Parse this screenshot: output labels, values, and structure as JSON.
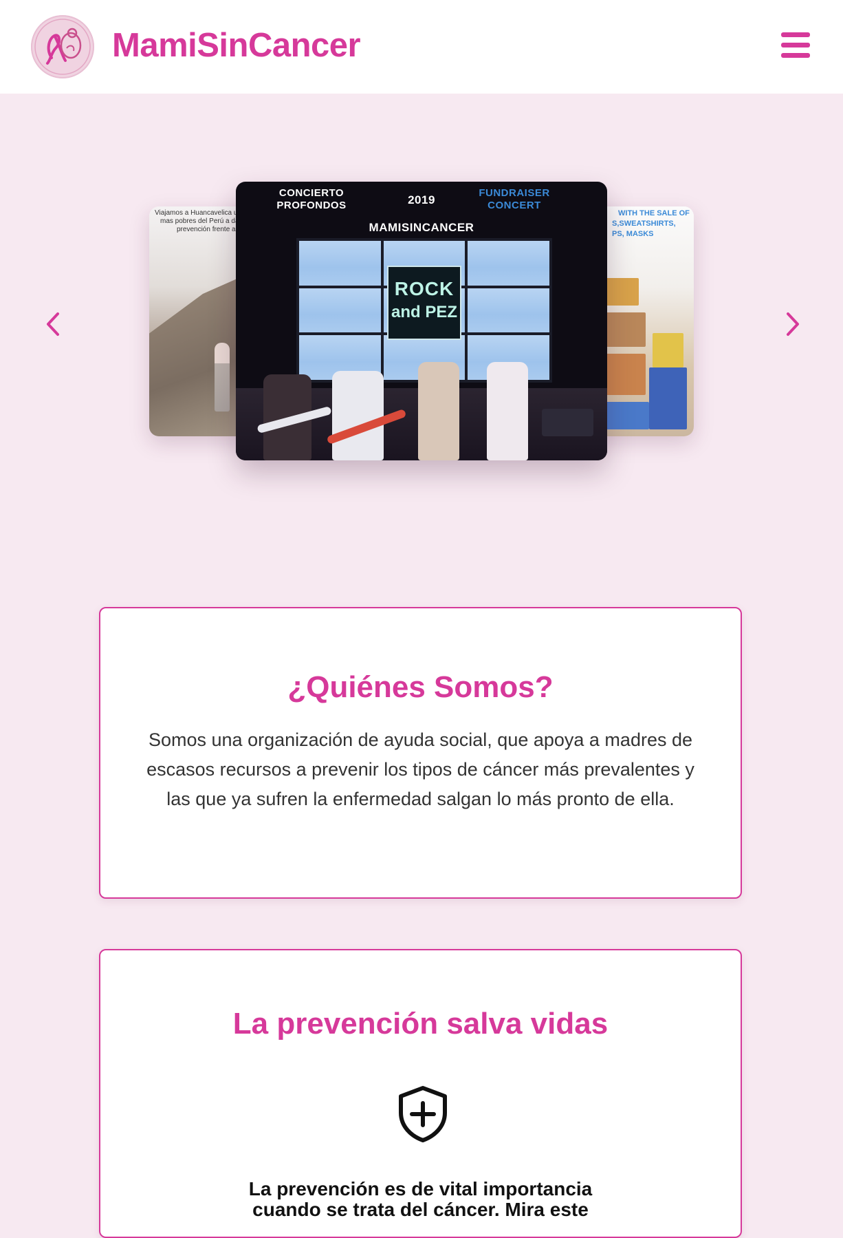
{
  "header": {
    "brand": "MamiSinCancer",
    "logo_icon": "ribbon-mother-logo",
    "menu_icon": "hamburger-menu-icon",
    "accent_color": "#d6399a"
  },
  "carousel": {
    "prev_icon": "chevron-left-icon",
    "next_icon": "chevron-right-icon",
    "left_slide": {
      "text_line1": "Viajamos a Huancavelica una de",
      "text_line2": "mas pobres del Perú a dar cha",
      "text_line3": "prevención frente al cán"
    },
    "main_slide": {
      "caption_left_line1": "CONCIERTO",
      "caption_left_line2": "PROFONDOS",
      "caption_year": "2019",
      "caption_right_line1": "FUNDRAISER",
      "caption_right_line2": "CONCERT",
      "caption_org": "MAMISINCANCER",
      "sign_line1": "ROCK",
      "sign_line2": "and PEZ"
    },
    "right_slide": {
      "text_line1": "WITH THE SALE OF",
      "text_line2": "S,SWEATSHIRTS,",
      "text_line3": "PS, MASKS"
    }
  },
  "about": {
    "title": "¿Quiénes Somos?",
    "body": "Somos una organización de ayuda social, que apoya a madres de escasos recursos a prevenir los tipos de cáncer más prevalentes y las que ya sufren la enfermedad salgan lo más pronto de ella."
  },
  "prevention": {
    "title": "La prevención salva vidas",
    "icon": "shield-plus-icon",
    "lead_line1": "La prevención es de vital importancia",
    "lead_line2": "cuando se trata del cáncer. Mira este"
  }
}
